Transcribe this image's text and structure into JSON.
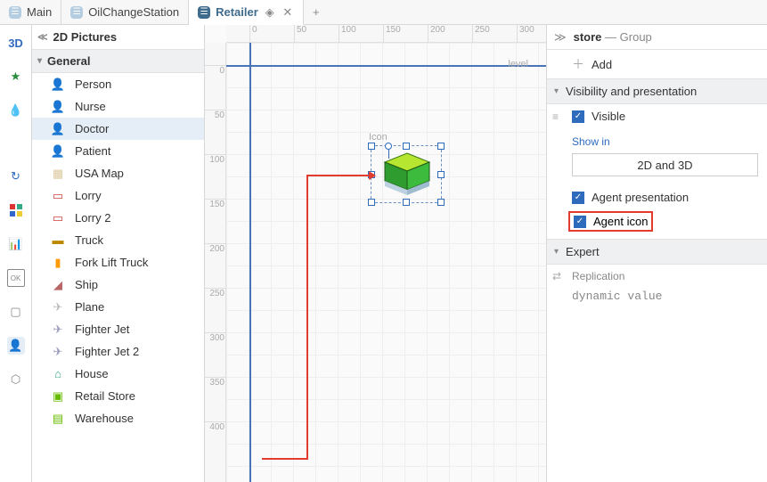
{
  "tabs": [
    {
      "label": "Main"
    },
    {
      "label": "OilChangeStation"
    },
    {
      "label": "Retailer",
      "active": true
    }
  ],
  "palette": {
    "title": "2D Pictures",
    "section": "General",
    "items": [
      "Person",
      "Nurse",
      "Doctor",
      "Patient",
      "USA Map",
      "Lorry",
      "Lorry 2",
      "Truck",
      "Fork Lift Truck",
      "Ship",
      "Plane",
      "Fighter Jet",
      "Fighter Jet 2",
      "House",
      "Retail Store",
      "Warehouse"
    ]
  },
  "canvas": {
    "level_label": "level",
    "icon_label": "Icon",
    "ruler_h": [
      "0",
      "50",
      "100",
      "150",
      "200",
      "250",
      "300"
    ],
    "ruler_v": [
      "0",
      "50",
      "100",
      "150",
      "200",
      "250",
      "300",
      "350",
      "400"
    ]
  },
  "props": {
    "title_a": "store",
    "title_b": "— Group",
    "add_label": "Add",
    "section_vis": "Visibility and presentation",
    "visible_label": "Visible",
    "showin_label": "Show in",
    "showin_value": "2D and 3D",
    "agent_pres": "Agent presentation",
    "agent_icon": "Agent icon",
    "section_expert": "Expert",
    "replication_label": "Replication",
    "dynamic_value": "dynamic value"
  }
}
